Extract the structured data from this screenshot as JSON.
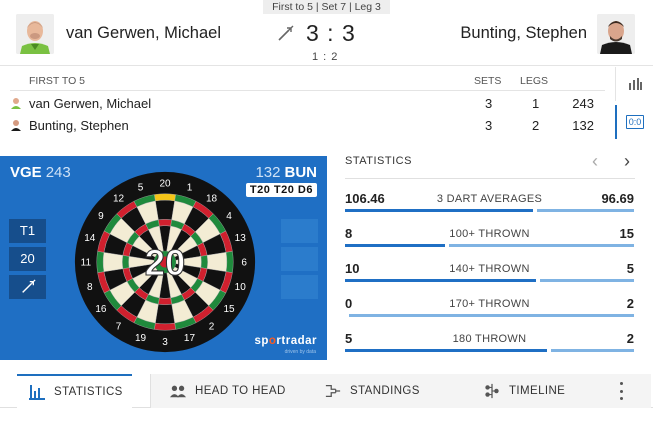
{
  "header": {
    "match_info": "First to 5 | Set 7 | Leg 3",
    "home_name": "van Gerwen, Michael",
    "away_name": "Bunting, Stephen",
    "sets_score": "3 : 3",
    "legs_score": "1 : 2",
    "throwing_icon": "dart-icon"
  },
  "scoreboard": {
    "format_label": "FIRST TO 5",
    "col_sets": "SETS",
    "col_legs": "LEGS",
    "rows": [
      {
        "name": "van Gerwen, Michael",
        "sets": "3",
        "legs": "1",
        "points": "243"
      },
      {
        "name": "Bunting, Stephen",
        "sets": "3",
        "legs": "2",
        "points": "132"
      }
    ],
    "chart_toggle_icon": "bar-chart-icon",
    "score_toggle_label": "0:0"
  },
  "board": {
    "home_abbr": "VGE",
    "home_remaining": "243",
    "away_abbr": "BUN",
    "away_remaining": "132",
    "checkout": "T20 T20 D6",
    "throws": [
      "T1",
      "20"
    ],
    "last_dart_icon": "dart-icon",
    "highlight_segment": "20",
    "center_number": "20",
    "numbers": [
      "20",
      "1",
      "18",
      "4",
      "13",
      "6",
      "10",
      "15",
      "2",
      "17",
      "3",
      "19",
      "7",
      "16",
      "8",
      "11",
      "14",
      "9",
      "12",
      "5"
    ],
    "logo_pre": "sp",
    "logo_o": "o",
    "logo_post": "rtradar",
    "logo_sub": "driven by data",
    "colors": {
      "panel": "#1f6fc4",
      "highlight": "#f5c518",
      "red": "#d0202e",
      "green": "#1f8a3c",
      "black": "#111111",
      "cream": "#f3ecd4"
    }
  },
  "statistics": {
    "title": "STATISTICS",
    "prev_icon": "chevron-left-icon",
    "next_icon": "chevron-right-icon",
    "rows": [
      {
        "label": "3 DART AVERAGES",
        "home": "106.46",
        "away": "96.69",
        "home_share": 0.66,
        "away_share": 0.34
      },
      {
        "label": "100+ THROWN",
        "home": "8",
        "away": "15",
        "home_share": 0.35,
        "away_share": 0.65
      },
      {
        "label": "140+ THROWN",
        "home": "10",
        "away": "5",
        "home_share": 0.67,
        "away_share": 0.33
      },
      {
        "label": "170+ THROWN",
        "home": "0",
        "away": "2",
        "home_share": 0.0,
        "away_share": 1.0
      },
      {
        "label": "180 THROWN",
        "home": "5",
        "away": "2",
        "home_share": 0.71,
        "away_share": 0.29
      }
    ]
  },
  "tabs": {
    "items": [
      {
        "label": "STATISTICS",
        "icon": "bar-chart-icon",
        "active": true
      },
      {
        "label": "HEAD TO HEAD",
        "icon": "head-to-head-icon",
        "active": false
      },
      {
        "label": "STANDINGS",
        "icon": "standings-icon",
        "active": false
      },
      {
        "label": "TIMELINE",
        "icon": "timeline-icon",
        "active": false
      }
    ],
    "more_icon": "more-vertical-icon"
  }
}
